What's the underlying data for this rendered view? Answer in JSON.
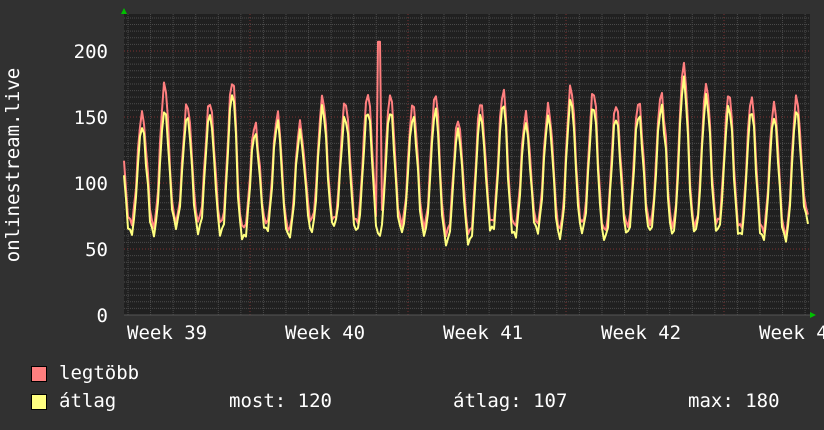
{
  "chart_data": {
    "type": "line",
    "ylabel": "onlinestream.live",
    "ylim": [
      0,
      228
    ],
    "yticks": [
      0,
      50,
      100,
      150,
      200
    ],
    "xticks": [
      "Week 39",
      "Week 40",
      "Week 41",
      "Week 42",
      "Week 4"
    ],
    "grid": true,
    "legend_placement": "bottom-left",
    "colors": {
      "background": "#313131",
      "plot": "#202020",
      "major_grid": "#7a3030",
      "minor_grid": "#4a4a4a",
      "axis_arrow": "#00c000"
    },
    "x_unit": "day",
    "series": [
      {
        "name": "legtöbb",
        "color": "#ff7f7f",
        "daily_peak": [
          153,
          175,
          160,
          162,
          178,
          145,
          152,
          145,
          165,
          162,
          168,
          167,
          160,
          167,
          148,
          162,
          170,
          152,
          158,
          173,
          170,
          160,
          162,
          168,
          190,
          175,
          168,
          165,
          160,
          165,
          155
        ],
        "daily_trough": [
          70,
          68,
          72,
          72,
          70,
          66,
          70,
          65,
          72,
          72,
          70,
          68,
          70,
          68,
          62,
          62,
          70,
          68,
          70,
          66,
          70,
          64,
          68,
          70,
          68,
          68,
          70,
          66,
          64,
          62,
          78
        ],
        "spikes": [
          {
            "day": 11.3,
            "value": 207
          }
        ]
      },
      {
        "name": "átlag",
        "color": "#ffff80",
        "daily_peak": [
          143,
          155,
          150,
          152,
          168,
          138,
          146,
          138,
          157,
          150,
          155,
          155,
          150,
          155,
          140,
          152,
          160,
          145,
          150,
          163,
          158,
          150,
          152,
          158,
          178,
          165,
          158,
          155,
          150,
          155,
          145
        ],
        "daily_trough": [
          62,
          62,
          68,
          64,
          62,
          58,
          64,
          60,
          64,
          68,
          64,
          60,
          64,
          62,
          55,
          55,
          64,
          60,
          64,
          60,
          64,
          58,
          62,
          64,
          62,
          64,
          64,
          60,
          58,
          58,
          72
        ]
      }
    ]
  },
  "legend": {
    "max_label": "legtöbb",
    "avg_label": "átlag",
    "current": "most: 120",
    "average": "átlag: 107",
    "maximum": "max: 180"
  }
}
